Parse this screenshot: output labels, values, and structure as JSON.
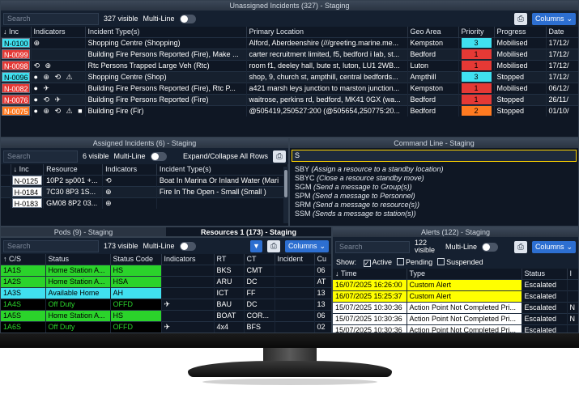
{
  "colors": {
    "red": "#e53935",
    "cyan": "#40e0f0",
    "orange": "#ff7a21",
    "green": "#31d17a",
    "lime": "#2bd32b",
    "yellow": "#ffff00",
    "black": "#000000",
    "white": "#ffffff"
  },
  "unassigned": {
    "title": "Unassigned Incidents (327) - Staging",
    "search_placeholder": "Search",
    "visible": "327 visible",
    "multiline": "Multi-Line",
    "columns_btn": "Columns",
    "headers": [
      "↓ Inc",
      "Indicators",
      "Incident Type(s)",
      "Primary Location",
      "Geo Area",
      "Priority",
      "Progress",
      "Date"
    ],
    "rows": [
      {
        "inc": "N-0100",
        "bg": "#40e0f0",
        "fg": "#000",
        "ind": "⊕",
        "type": "Shopping Centre (Shopping)",
        "loc": "Alford, Aberdeenshire (///greeting.marine.me...",
        "geo": "Kempston",
        "pri": "3",
        "pribg": "#40e0f0",
        "prog": "Mobilised",
        "date": "17/12/"
      },
      {
        "inc": "N-0099",
        "bg": "#e53935",
        "fg": "#fff",
        "ind": "",
        "type": "Building Fire Persons Reported (Fire), Make ...",
        "loc": "carter recruitment limited, f5, bedford i lab, st...",
        "geo": "Bedford",
        "pri": "1",
        "pribg": "#e53935",
        "prog": "Mobilised",
        "date": "17/12/"
      },
      {
        "inc": "N-0098",
        "bg": "#e53935",
        "fg": "#fff",
        "ind": "⟲ ⊕",
        "type": "Rtc Persons Trapped Large Veh (Rtc)",
        "loc": "room f1, deeley hall, bute st, luton, LU1 2WB...",
        "geo": "Luton",
        "pri": "1",
        "pribg": "#e53935",
        "prog": "Mobilised",
        "date": "17/12/"
      },
      {
        "inc": "N-0096",
        "bg": "#40e0f0",
        "fg": "#000",
        "ind": "● ⊕ ⟲ ⚠",
        "type": "Shopping Centre (Shop)",
        "loc": "shop, 9, church st, ampthill, central bedfords...",
        "geo": "Ampthill",
        "pri": "3",
        "pribg": "#40e0f0",
        "prog": "Stopped",
        "date": "17/12/"
      },
      {
        "inc": "N-0082",
        "bg": "#e53935",
        "fg": "#fff",
        "ind": "● ✈",
        "type": "Building Fire Persons Reported (Fire), Rtc P...",
        "loc": "a421 marsh leys junction to marston junction...",
        "geo": "Kempston",
        "pri": "1",
        "pribg": "#e53935",
        "prog": "Mobilised",
        "date": "06/12/"
      },
      {
        "inc": "N-0076",
        "bg": "#e53935",
        "fg": "#fff",
        "ind": "● ⟲ ✈",
        "type": "Building Fire Persons Reported (Fire)",
        "loc": "waitrose, perkins rd, bedford, MK41 0GX (wa...",
        "geo": "Bedford",
        "pri": "1",
        "pribg": "#e53935",
        "prog": "Stopped",
        "date": "26/11/"
      },
      {
        "inc": "N-0075",
        "bg": "#ff7a21",
        "fg": "#fff",
        "ind": "● ⊕ ⟲ ⚠ ■",
        "type": "Building Fire (Fir)",
        "loc": "@505419,250527:200 (@505654,250775:20...",
        "geo": "Bedford",
        "pri": "2",
        "pribg": "#ff7a21",
        "prog": "Stopped",
        "date": "01/10/"
      }
    ]
  },
  "assigned": {
    "title": "Assigned Incidents (6) - Staging",
    "search_placeholder": "Search",
    "visible": "6 visible",
    "multiline": "Multi-Line",
    "expand": "Expand/Collapse All Rows",
    "headers": [
      "",
      "↓ Inc",
      "Resource",
      "Indicators",
      "Incident Type(s)"
    ],
    "rows": [
      {
        "inc": "N-0125",
        "bg": "#ffffff",
        "fg": "#000",
        "res": "10P2 sp001 +...",
        "ind": "⟲",
        "type": "Boat In Marina Or Inland Water (Mari"
      },
      {
        "inc": "H-0184",
        "bg": "#ffffff",
        "fg": "#000",
        "res": "7C30 8P3 1S...",
        "ind": "⊕",
        "type": "Fire In The Open - Small (Small )"
      },
      {
        "inc": "H-0183",
        "bg": "#ffffff",
        "fg": "#000",
        "res": "GM08 8P2 03...",
        "ind": "⊕",
        "type": ""
      }
    ]
  },
  "command": {
    "title": "Command Line - Staging",
    "input": "S",
    "items": [
      {
        "code": "SBY",
        "desc": "(Assign a resource to a standby location)"
      },
      {
        "code": "SBYC",
        "desc": "(Close a resource standby move)"
      },
      {
        "code": "SGM",
        "desc": "(Send a message to Group(s))"
      },
      {
        "code": "SPM",
        "desc": "(Send a message to Personnel)"
      },
      {
        "code": "SRM",
        "desc": "(Send a message to resource(s))"
      },
      {
        "code": "SSM",
        "desc": "(Sends a message to station(s))"
      }
    ]
  },
  "tabs": [
    {
      "label": "Pods (9) - Staging"
    },
    {
      "label": "Resources 1 (173) - Staging"
    }
  ],
  "resources": {
    "search_placeholder": "Search",
    "visible": "173 visible",
    "multiline": "Multi-Line",
    "columns_btn": "Columns",
    "headers": [
      "↑ C/S",
      "Status",
      "Status Code",
      "Indicators",
      "RT",
      "CT",
      "Incident",
      "Cu"
    ],
    "rows": [
      {
        "cs": "1A1S",
        "status": "Home Station A...",
        "code": "HS",
        "bg": "#2bd32b",
        "fg": "#000",
        "ind": "",
        "rt": "BKS",
        "ct": "CMT",
        "cu": "06"
      },
      {
        "cs": "1A2S",
        "status": "Home Station A...",
        "code": "HSA",
        "bg": "#2bd32b",
        "fg": "#000",
        "ind": "",
        "rt": "ARU",
        "ct": "DC",
        "cu": "AT"
      },
      {
        "cs": "1A3S",
        "status": "Available Home",
        "code": "AH",
        "bg": "#40e0f0",
        "fg": "#000",
        "ind": "",
        "rt": "ICT",
        "ct": "FF",
        "cu": "13"
      },
      {
        "cs": "1A4S",
        "status": "Off Duty",
        "code": "OFFD",
        "bg": "#000000",
        "fg": "#2bd32b",
        "ind": "✈",
        "rt": "BAU",
        "ct": "DC",
        "cu": "13"
      },
      {
        "cs": "1A5S",
        "status": "Home Station A...",
        "code": "HS",
        "bg": "#2bd32b",
        "fg": "#000",
        "ind": "",
        "rt": "BOAT",
        "ct": "COR...",
        "cu": "06"
      },
      {
        "cs": "1A6S",
        "status": "Off Duty",
        "code": "OFFD",
        "bg": "#000000",
        "fg": "#2bd32b",
        "ind": "✈",
        "rt": "4x4",
        "ct": "BFS",
        "cu": "02"
      }
    ]
  },
  "alerts": {
    "title": "Alerts (122) - Staging",
    "search_placeholder": "Search",
    "visible": "122 visible",
    "multiline": "Multi-Line",
    "columns_btn": "Columns",
    "show_label": "Show:",
    "filters": [
      {
        "label": "Active",
        "checked": true
      },
      {
        "label": "Pending",
        "checked": false
      },
      {
        "label": "Suspended",
        "checked": false
      }
    ],
    "headers": [
      "↓ Time",
      "Type",
      "Status",
      "I"
    ],
    "rows": [
      {
        "time": "16/07/2025 16:26:00",
        "type": "Custom Alert",
        "status": "Escalated",
        "bg": "#ffff00",
        "fg": "#000",
        "i": ""
      },
      {
        "time": "16/07/2025 15:25:37",
        "type": "Custom Alert",
        "status": "Escalated",
        "bg": "#ffff00",
        "fg": "#000",
        "i": ""
      },
      {
        "time": "15/07/2025 10:30:36",
        "type": "Action Point Not Completed Pri...",
        "status": "Escalated",
        "bg": "#ffffff",
        "fg": "#000",
        "i": "N"
      },
      {
        "time": "15/07/2025 10:30:36",
        "type": "Action Point Not Completed Pri...",
        "status": "Escalated",
        "bg": "#ffffff",
        "fg": "#000",
        "i": "N"
      },
      {
        "time": "15/07/2025 10:30:36",
        "type": "Action Point Not Completed Pri...",
        "status": "Escalated",
        "bg": "#ffffff",
        "fg": "#000",
        "i": ""
      }
    ]
  }
}
